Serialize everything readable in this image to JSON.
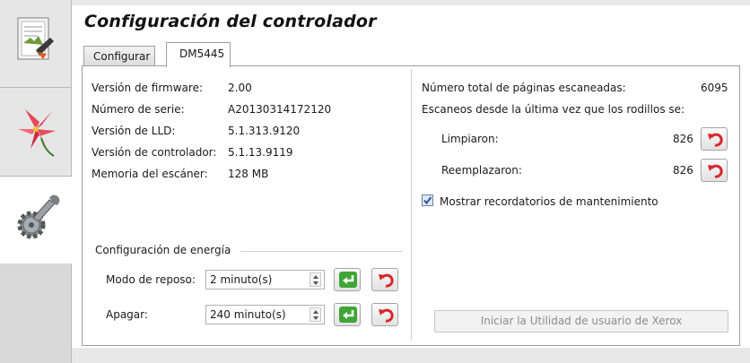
{
  "header": {
    "title": "Configuración del controlador"
  },
  "tabs": [
    {
      "label": "Configurar"
    },
    {
      "label": "DM5445"
    }
  ],
  "info": [
    {
      "label": "Versión de firmware:",
      "value": "2.00"
    },
    {
      "label": "Número de serie:",
      "value": "A20130314172120"
    },
    {
      "label": "Versión de LLD:",
      "value": "5.1.313.9120"
    },
    {
      "label": "Versión de controlador:",
      "value": "5.1.13.9119"
    },
    {
      "label": "Memoria del escáner:",
      "value": "128 MB"
    }
  ],
  "energy": {
    "group_label": "Configuración de energía",
    "sleep": {
      "label": "Modo de reposo:",
      "value": "2 minuto(s)"
    },
    "off": {
      "label": "Apagar:",
      "value": "240 minuto(s)"
    }
  },
  "maintenance": {
    "total_label": "Número total de páginas escaneadas:",
    "total_value": "6095",
    "since_label": "Escaneos desde la última vez que los rodillos se:",
    "cleaned": {
      "label": "Limpiaron:",
      "value": "826"
    },
    "replaced": {
      "label": "Reemplazaron:",
      "value": "826"
    },
    "reminder_label": "Mostrar recordatorios de mantenimiento",
    "reminder_checked": true
  },
  "launch_button": "Iniciar la Utilidad de usuario de Xerox",
  "icons": {
    "apply": "green-check-arrow-icon",
    "reset": "red-undo-icon",
    "sidebar": [
      "scan-document-icon",
      "lily-flower-icon",
      "gear-wrench-icon"
    ]
  },
  "colors": {
    "apply_green": "#3fa535",
    "reset_red": "#d8262c",
    "checkbox_blue": "#2b55a8"
  }
}
